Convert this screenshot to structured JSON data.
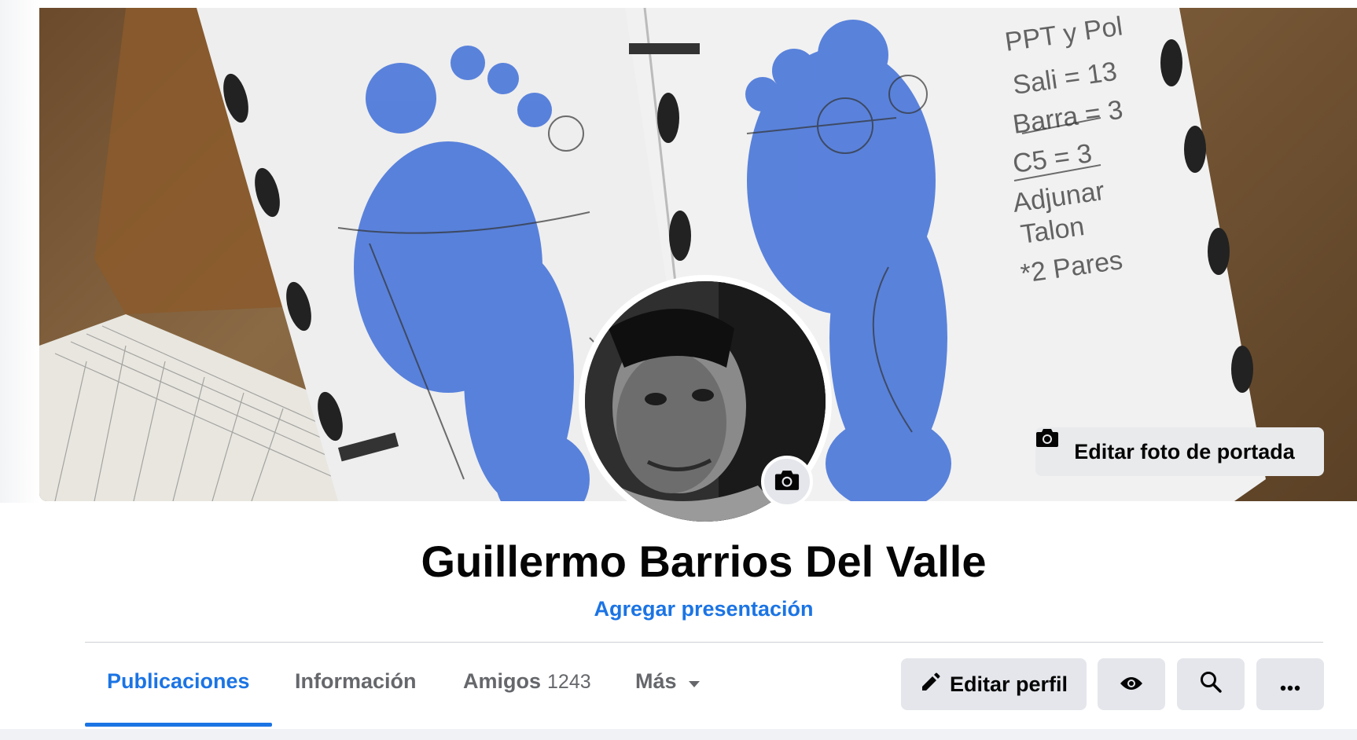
{
  "profile": {
    "name": "Guillermo Barrios Del Valle",
    "add_bio_label": "Agregar presentación"
  },
  "cover": {
    "edit_cover_label": "Editar foto de portada",
    "icon": "camera-icon"
  },
  "avatar": {
    "icon": "camera-icon"
  },
  "tabs": [
    {
      "label": "Publicaciones",
      "active": true
    },
    {
      "label": "Información"
    },
    {
      "label": "Amigos",
      "count": "1243"
    },
    {
      "label": "Más",
      "icon": "caret-down-icon"
    }
  ],
  "actions": {
    "edit_profile_label": "Editar perfil",
    "edit_icon": "pencil-icon",
    "view_as_icon": "eye-icon",
    "search_icon": "search-icon",
    "more_icon": "ellipsis-icon"
  },
  "colors": {
    "accent": "#1b74e4",
    "button_bg": "#e4e6eb",
    "text_primary": "#050505",
    "text_secondary": "#65676b"
  }
}
